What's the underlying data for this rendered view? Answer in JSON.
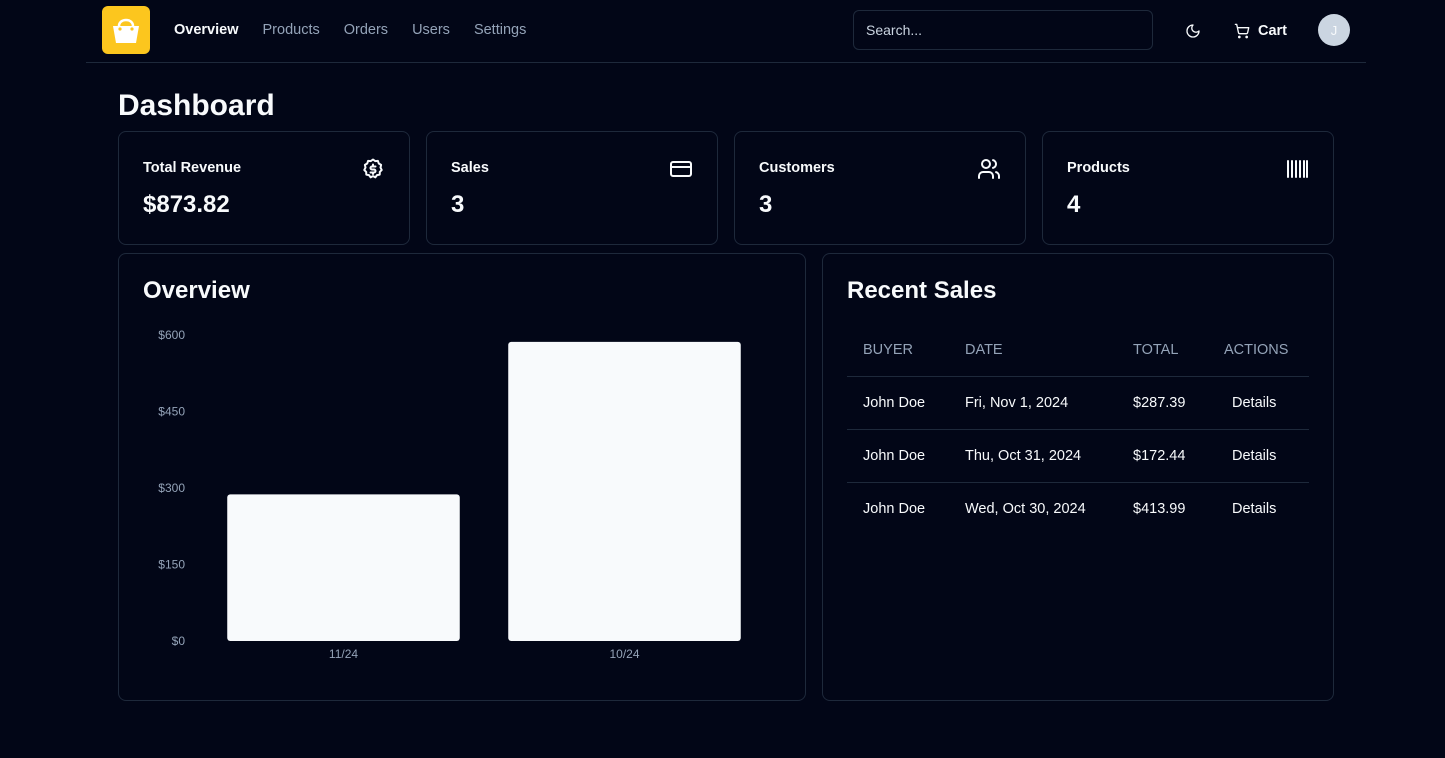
{
  "header": {
    "logo_icon": "shopping-bag-icon",
    "nav": [
      {
        "label": "Overview",
        "active": true
      },
      {
        "label": "Products",
        "active": false
      },
      {
        "label": "Orders",
        "active": false
      },
      {
        "label": "Users",
        "active": false
      },
      {
        "label": "Settings",
        "active": false
      }
    ],
    "search_placeholder": "Search...",
    "theme_icon": "moon-icon",
    "cart_label": "Cart",
    "avatar_initial": "J"
  },
  "page_title": "Dashboard",
  "stats": [
    {
      "label": "Total Revenue",
      "value": "$873.82",
      "icon": "dollar-circle-icon"
    },
    {
      "label": "Sales",
      "value": "3",
      "icon": "credit-card-icon"
    },
    {
      "label": "Customers",
      "value": "3",
      "icon": "users-icon"
    },
    {
      "label": "Products",
      "value": "4",
      "icon": "barcode-icon"
    }
  ],
  "overview": {
    "title": "Overview"
  },
  "chart_data": {
    "type": "bar",
    "categories": [
      "11/24",
      "10/24"
    ],
    "values": [
      287.39,
      586.43
    ],
    "yticks": [
      "$0",
      "$150",
      "$300",
      "$450",
      "$600"
    ],
    "ylim": [
      0,
      600
    ],
    "grid": false,
    "bar_color": "#f8fafc"
  },
  "recent_sales": {
    "title": "Recent Sales",
    "columns": [
      "BUYER",
      "DATE",
      "TOTAL",
      "ACTIONS"
    ],
    "rows": [
      {
        "buyer": "John Doe",
        "date": "Fri, Nov 1, 2024",
        "total": "$287.39",
        "action": "Details"
      },
      {
        "buyer": "John Doe",
        "date": "Thu, Oct 31, 2024",
        "total": "$172.44",
        "action": "Details"
      },
      {
        "buyer": "John Doe",
        "date": "Wed, Oct 30, 2024",
        "total": "$413.99",
        "action": "Details"
      }
    ]
  },
  "colors": {
    "background": "#020617",
    "border": "#1e293b",
    "accent": "#fcc61e",
    "muted_text": "#94a3b8"
  }
}
